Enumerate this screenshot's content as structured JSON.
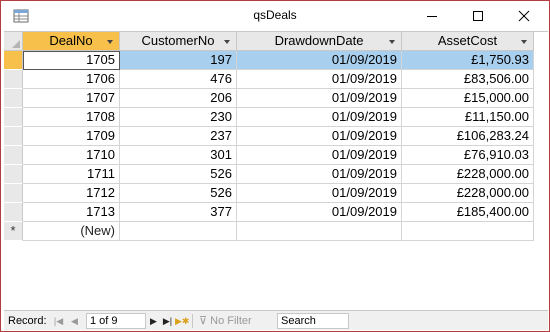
{
  "window": {
    "title": "qsDeals",
    "minimize_icon": "minimize-icon",
    "maximize_icon": "maximize-icon",
    "close_icon": "close-icon"
  },
  "table": {
    "columns": [
      "DealNo",
      "CustomerNo",
      "DrawdownDate",
      "AssetCost"
    ],
    "rows": [
      [
        "1705",
        "197",
        "01/09/2019",
        "£1,750.93"
      ],
      [
        "1706",
        "476",
        "01/09/2019",
        "£83,506.00"
      ],
      [
        "1707",
        "206",
        "01/09/2019",
        "£15,000.00"
      ],
      [
        "1708",
        "230",
        "01/09/2019",
        "£11,150.00"
      ],
      [
        "1709",
        "237",
        "01/09/2019",
        "£106,283.24"
      ],
      [
        "1710",
        "301",
        "01/09/2019",
        "£76,910.03"
      ],
      [
        "1711",
        "526",
        "01/09/2019",
        "£228,000.00"
      ],
      [
        "1712",
        "526",
        "01/09/2019",
        "£228,000.00"
      ],
      [
        "1713",
        "377",
        "01/09/2019",
        "£185,400.00"
      ]
    ],
    "new_row_marker": "*",
    "new_row_label": "(New)"
  },
  "navigator": {
    "record_label": "Record:",
    "record_value": "1 of 9",
    "filter_label": "No Filter",
    "search_placeholder": "Search"
  },
  "colors": {
    "accent_selected_row": "#a9cfee",
    "current_selector": "#f6c04a",
    "window_border": "#b33c3c"
  }
}
